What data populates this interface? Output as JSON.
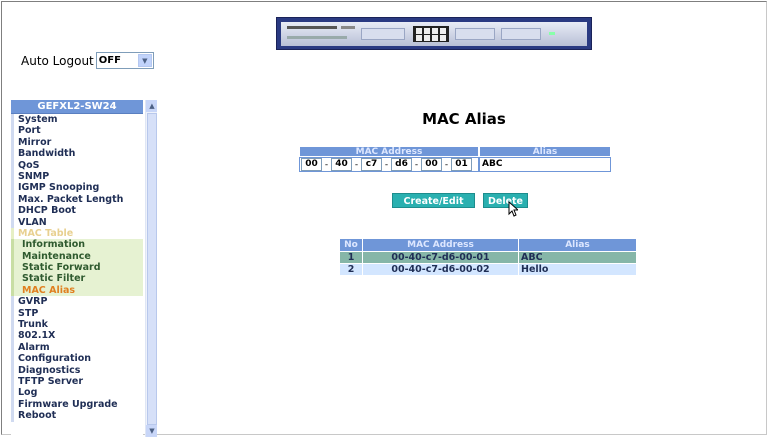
{
  "auto_logout": {
    "label": "Auto Logout",
    "value": "OFF"
  },
  "sidebar": {
    "header": "GEFXL2-SW24",
    "items": [
      {
        "label": "System",
        "kind": "item"
      },
      {
        "label": "Port",
        "kind": "item"
      },
      {
        "label": "Mirror",
        "kind": "item"
      },
      {
        "label": "Bandwidth",
        "kind": "item"
      },
      {
        "label": "QoS",
        "kind": "item"
      },
      {
        "label": "SNMP",
        "kind": "item"
      },
      {
        "label": "IGMP Snooping",
        "kind": "item"
      },
      {
        "label": "Max. Packet Length",
        "kind": "item"
      },
      {
        "label": "DHCP Boot",
        "kind": "item"
      },
      {
        "label": "VLAN",
        "kind": "item"
      },
      {
        "label": "MAC Table",
        "kind": "open"
      },
      {
        "label": "Information",
        "kind": "sub"
      },
      {
        "label": "Maintenance",
        "kind": "sub"
      },
      {
        "label": "Static Forward",
        "kind": "sub"
      },
      {
        "label": "Static Filter",
        "kind": "sub"
      },
      {
        "label": "MAC Alias",
        "kind": "sub-active"
      },
      {
        "label": "GVRP",
        "kind": "item"
      },
      {
        "label": "STP",
        "kind": "item"
      },
      {
        "label": "Trunk",
        "kind": "item"
      },
      {
        "label": "802.1X",
        "kind": "item"
      },
      {
        "label": "Alarm",
        "kind": "item"
      },
      {
        "label": "Configuration",
        "kind": "item"
      },
      {
        "label": "Diagnostics",
        "kind": "item"
      },
      {
        "label": "TFTP Server",
        "kind": "item"
      },
      {
        "label": "Log",
        "kind": "item"
      },
      {
        "label": "Firmware Upgrade",
        "kind": "item"
      },
      {
        "label": "Reboot",
        "kind": "item"
      }
    ]
  },
  "main": {
    "title": "MAC Alias",
    "form": {
      "mac_header": "MAC Address",
      "alias_header": "Alias",
      "octets": [
        "00",
        "40",
        "c7",
        "d6",
        "00",
        "01"
      ],
      "alias_value": "ABC"
    },
    "buttons": {
      "create_edit": "Create/Edit",
      "delete": "Delete"
    },
    "table": {
      "headers": [
        "No",
        "MAC Address",
        "Alias"
      ],
      "rows": [
        [
          "1",
          "00-40-c7-d6-00-01",
          "ABC"
        ],
        [
          "2",
          "00-40-c7-d6-00-02",
          "Hello"
        ]
      ]
    }
  },
  "colors": {
    "header_blue": "#6f96d8",
    "button_teal": "#2ab0b0",
    "selected_row": "#86b6a8",
    "row_light": "#d3e6ff",
    "active_sub_item": "#e08020"
  }
}
